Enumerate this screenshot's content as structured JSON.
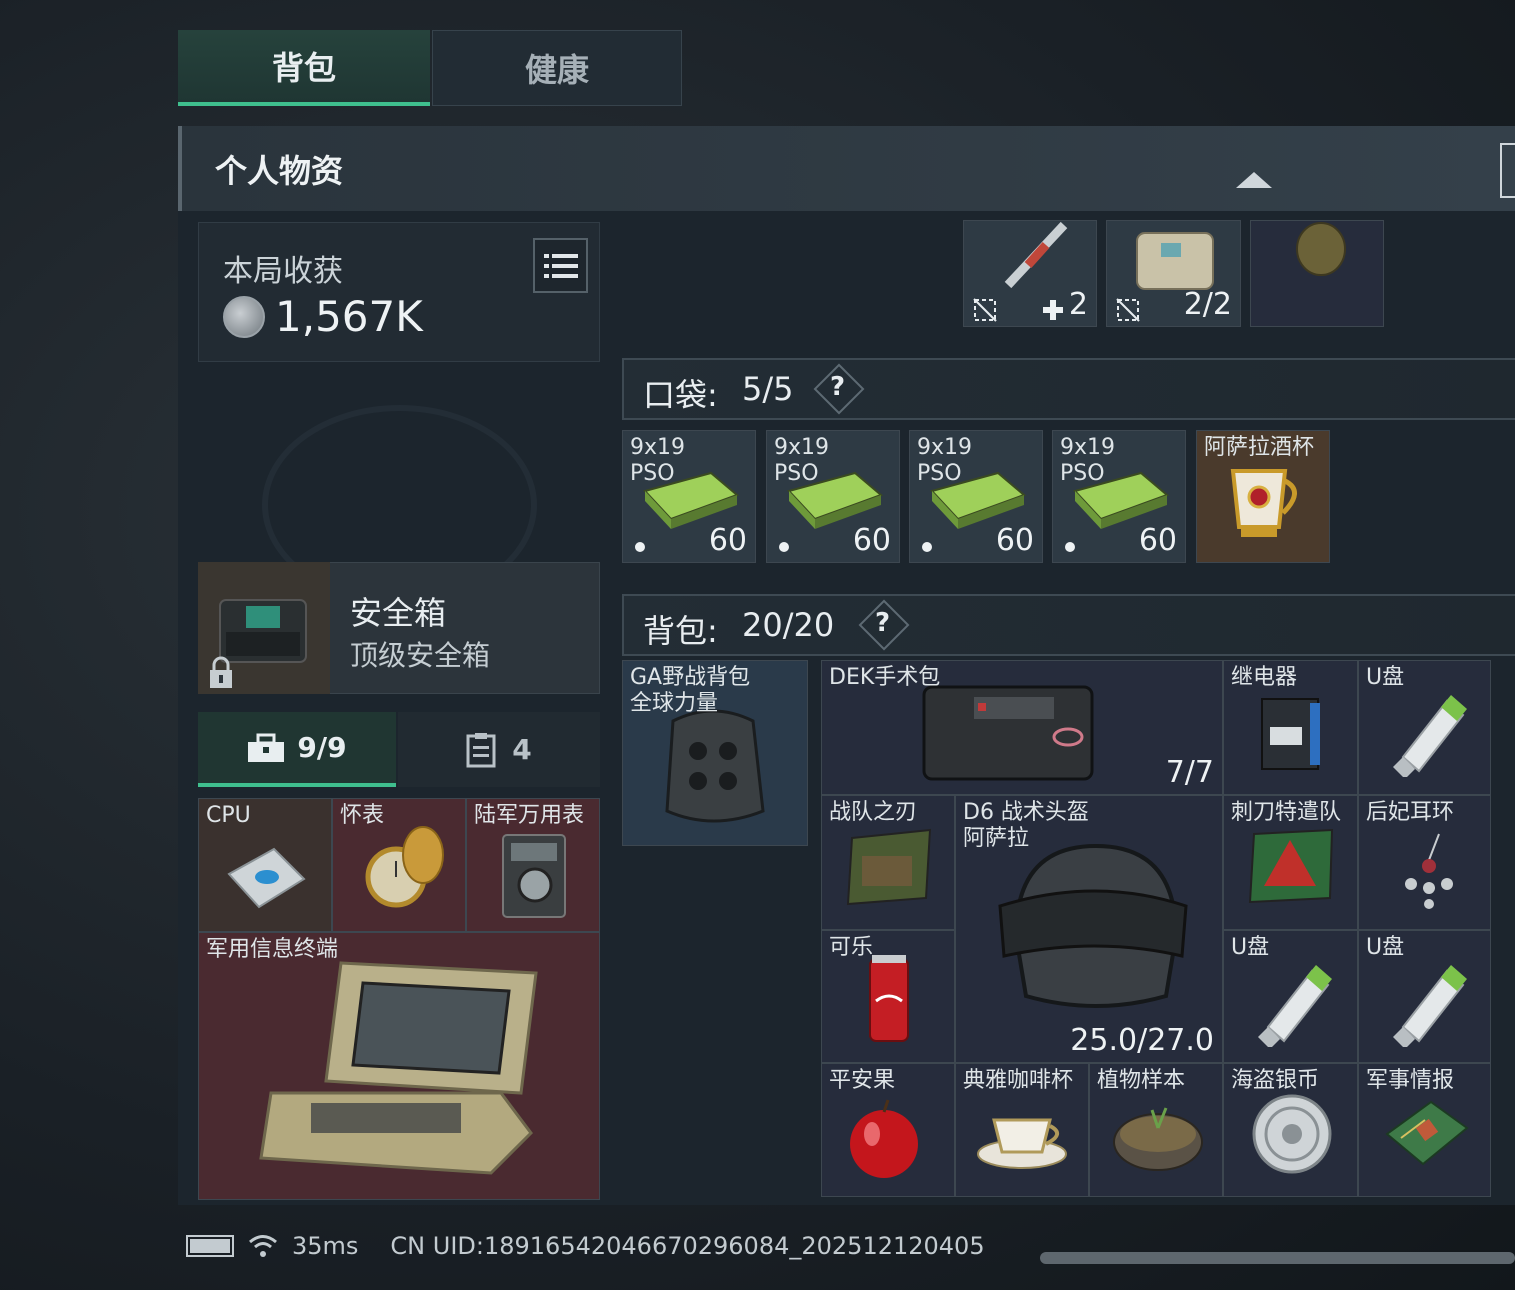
{
  "tabs": [
    {
      "label": "背包"
    },
    {
      "label": "健康"
    }
  ],
  "header": {
    "title": "个人物资"
  },
  "harvest": {
    "label": "本局收获",
    "value": "1,567K"
  },
  "safe_box": {
    "name": "安全箱",
    "subtitle": "顶级安全箱"
  },
  "container_tabs": {
    "first_count": "9/9",
    "second_count": "4"
  },
  "safe_items": [
    {
      "label": "CPU"
    },
    {
      "label": "怀表"
    },
    {
      "label": "陆军万用表"
    },
    {
      "label": "军用信息终端"
    }
  ],
  "top_slots": {
    "slot1_count": "2",
    "slot2_count": "2/2"
  },
  "pocket": {
    "label": "口袋:",
    "count": "5/5",
    "help": "?"
  },
  "pocket_items": [
    {
      "label1": "9x19",
      "label2": "PSO",
      "count": "60"
    },
    {
      "label1": "9x19",
      "label2": "PSO",
      "count": "60"
    },
    {
      "label1": "9x19",
      "label2": "PSO",
      "count": "60"
    },
    {
      "label1": "9x19",
      "label2": "PSO",
      "count": "60"
    },
    {
      "label1": "阿萨拉酒杯",
      "label2": "",
      "count": ""
    }
  ],
  "backpack": {
    "label": "背包:",
    "count": "20/20",
    "help": "?"
  },
  "backpack_slot": {
    "label1": "GA野战背包",
    "label2": "全球力量"
  },
  "backpack_items": {
    "dek": {
      "label": "DEK手术包",
      "count": "7/7"
    },
    "relay": {
      "label": "继电器"
    },
    "usb1": {
      "label": "U盘"
    },
    "blade": {
      "label": "战队之刃"
    },
    "helmet": {
      "label1": "D6 战术头盔",
      "label2": "阿萨拉",
      "count": "25.0/27.0"
    },
    "dagger": {
      "label": "刺刀特遣队"
    },
    "earring": {
      "label": "后妃耳环"
    },
    "cola": {
      "label": "可乐"
    },
    "usb2": {
      "label": "U盘"
    },
    "usb3": {
      "label": "U盘"
    },
    "apple": {
      "label": "平安果"
    },
    "coffee": {
      "label": "典雅咖啡杯"
    },
    "plant": {
      "label": "植物样本"
    },
    "coin": {
      "label": "海盗银币"
    },
    "intel": {
      "label": "军事情报"
    }
  },
  "status": {
    "ping": "35ms",
    "uid": "CN UID:18916542046670296084_202512120405"
  }
}
